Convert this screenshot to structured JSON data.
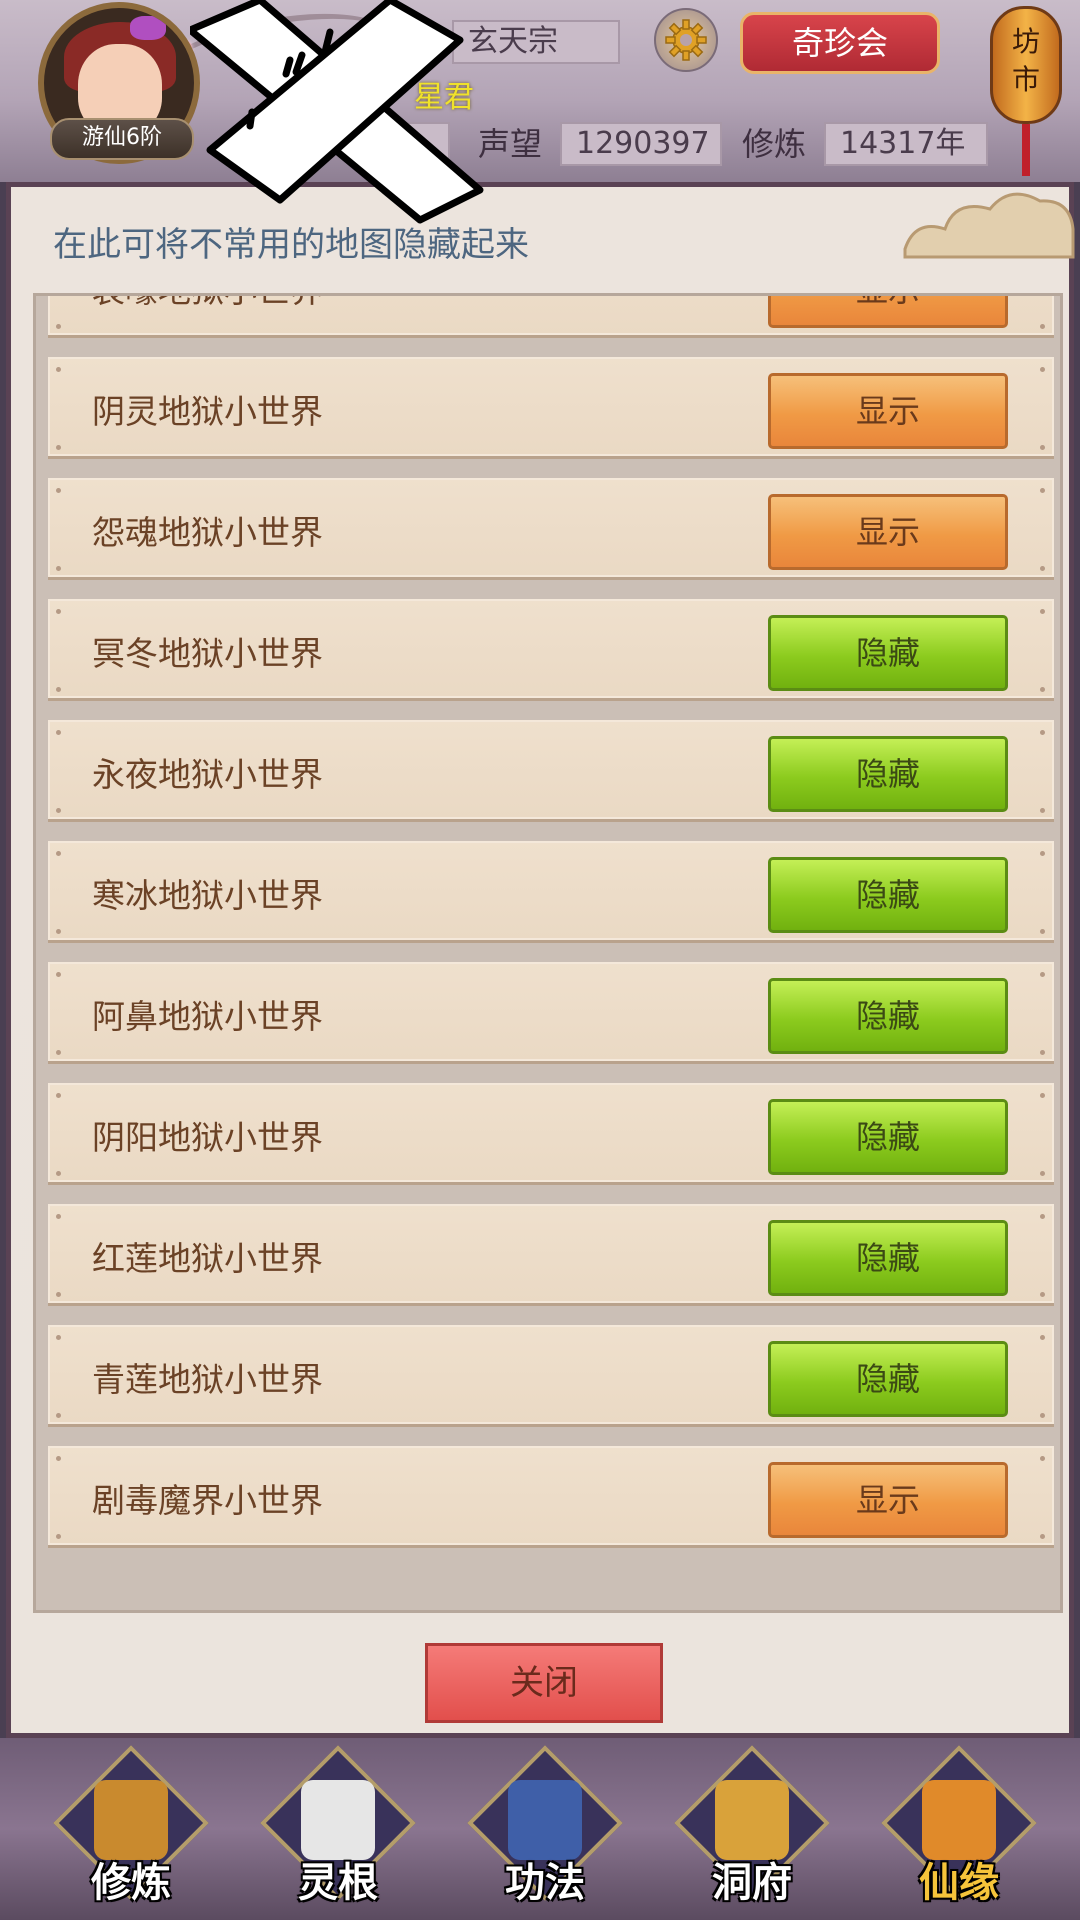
{
  "header": {
    "rank": "游仙6阶",
    "sect": "玄天宗",
    "title_name": "星君",
    "reputation_label": "声望",
    "reputation_value": "1290397",
    "cultivation_label": "修炼",
    "cultivation_value": "14317年",
    "treasure_button": "奇珍会",
    "market_lantern": "坊市"
  },
  "panel": {
    "description": "在此可将不常用的地图隐藏起来",
    "rows": [
      {
        "name": "哀嚎地狱小世界",
        "action": "显示",
        "state": "hidden"
      },
      {
        "name": "阴灵地狱小世界",
        "action": "显示",
        "state": "hidden"
      },
      {
        "name": "怨魂地狱小世界",
        "action": "显示",
        "state": "hidden"
      },
      {
        "name": "冥冬地狱小世界",
        "action": "隐藏",
        "state": "shown"
      },
      {
        "name": "永夜地狱小世界",
        "action": "隐藏",
        "state": "shown"
      },
      {
        "name": "寒冰地狱小世界",
        "action": "隐藏",
        "state": "shown"
      },
      {
        "name": "阿鼻地狱小世界",
        "action": "隐藏",
        "state": "shown"
      },
      {
        "name": "阴阳地狱小世界",
        "action": "隐藏",
        "state": "shown"
      },
      {
        "name": "红莲地狱小世界",
        "action": "隐藏",
        "state": "shown"
      },
      {
        "name": "青莲地狱小世界",
        "action": "隐藏",
        "state": "shown"
      },
      {
        "name": "剧毒魔界小世界",
        "action": "显示",
        "state": "hidden"
      }
    ],
    "close_button": "关闭"
  },
  "nav": {
    "items": [
      {
        "label": "修炼",
        "icon": "meditating-monk-icon",
        "active": false
      },
      {
        "label": "灵根",
        "icon": "yin-yang-sword-icon",
        "active": false
      },
      {
        "label": "功法",
        "icon": "scroll-book-icon",
        "active": false
      },
      {
        "label": "洞府",
        "icon": "pagoda-icon",
        "active": false
      },
      {
        "label": "仙缘",
        "icon": "gourd-icon",
        "active": true
      }
    ]
  },
  "colors": {
    "show_button": "#f09a45",
    "hide_button": "#8ccb1e",
    "close_button": "#e24f4c",
    "title_gold": "#f0e22a"
  }
}
